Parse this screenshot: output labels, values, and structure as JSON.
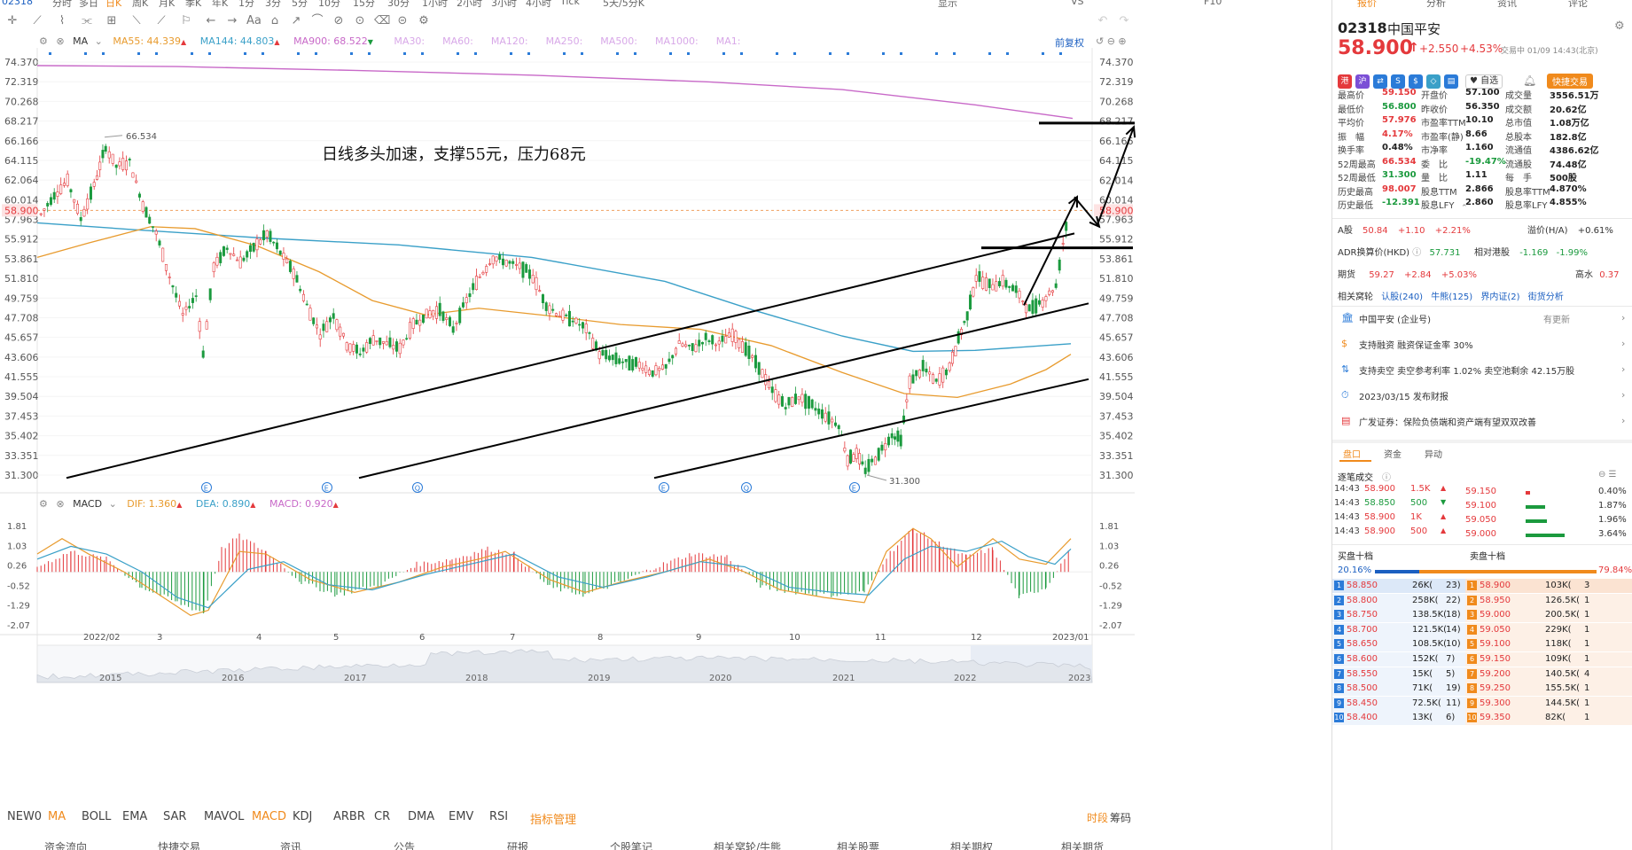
{
  "app": {
    "top_periods": [
      "02318",
      "分时",
      "多日",
      "日K",
      "周K",
      "月K",
      "季K",
      "年K",
      "1分",
      "3分",
      "5分",
      "10分",
      "15分",
      "30分",
      "1小时",
      "2小时",
      "3小时",
      "4小时",
      "Tick",
      "5天/5分K"
    ],
    "top_right": [
      "显示",
      "VS",
      "F10"
    ],
    "rpanel_tabs": [
      "报价",
      "分析",
      "资讯",
      "评论"
    ]
  },
  "chart": {
    "ma_legend": {
      "ma_label": "MA",
      "ma55": "MA55: 44.339",
      "ma144": "MA144: 44.803",
      "ma900": "MA900: 68.522",
      "others": [
        "MA30:",
        "MA60:",
        "MA120:",
        "MA250:",
        "MA500:",
        "MA1000:",
        "MA1:"
      ],
      "fuquan": "前复权"
    },
    "price_ticks": [
      "74.370",
      "72.319",
      "70.268",
      "68.217",
      "66.166",
      "64.115",
      "62.064",
      "60.014",
      "57.963",
      "55.912",
      "53.861",
      "51.810",
      "49.759",
      "47.708",
      "45.657",
      "43.606",
      "41.555",
      "39.504",
      "37.453",
      "35.402",
      "33.351",
      "31.300"
    ],
    "left_current_price": "58.900",
    "right_price_ticks": [
      "74.370",
      "72.319",
      "70.268",
      "68.217",
      "66.166",
      "64.115",
      "62.014",
      "60.014",
      "58.900",
      "57.963",
      "55.912",
      "53.861",
      "51.810",
      "49.759",
      "47.708",
      "45.657",
      "43.606",
      "41.555",
      "39.504",
      "37.453",
      "35.402",
      "33.351",
      "31.300"
    ],
    "high_label": "66.534",
    "low_label": "31.300",
    "annotation": "日线多头加速，支撑55元，压力68元",
    "event_markers": [
      "E",
      "E",
      "Q",
      "E",
      "Q",
      "E"
    ],
    "macd_legend": {
      "label": "MACD",
      "dif": "DIF: 1.360",
      "dea": "DEA: 0.890",
      "macd": "MACD: 0.920"
    },
    "macd_ticks": [
      "1.81",
      "1.03",
      "0.26",
      "-0.52",
      "-1.29",
      "-2.07"
    ],
    "x_months": [
      "2022/02",
      "3",
      "4",
      "5",
      "6",
      "7",
      "8",
      "9",
      "10",
      "11",
      "12",
      "2023/01"
    ],
    "overview_years": [
      "2015",
      "2016",
      "2017",
      "2018",
      "2019",
      "2020",
      "2021",
      "2022",
      "2023"
    ],
    "colors": {
      "ma55": "#e89b2e",
      "ma144": "#3aa0c8",
      "ma900": "#c869c8",
      "up": "#e4393c",
      "down": "#1b9a3e"
    }
  },
  "indicators": [
    "NEW0",
    "MA",
    "BOLL",
    "EMA",
    "SAR",
    "MAVOL",
    "MACD",
    "KDJ",
    "ARBR",
    "CR",
    "DMA",
    "EMV",
    "RSI",
    "指标管理"
  ],
  "indicators_right": [
    "时段",
    "筹码"
  ],
  "bottom_tabs": [
    "资金流向",
    "快捷交易",
    "资讯",
    "公告",
    "研报",
    "个股笔记",
    "相关窝轮/牛熊",
    "相关股票",
    "相关期权",
    "相关期货"
  ],
  "quote": {
    "code": "02318",
    "name": "中国平安",
    "price": "58.900",
    "change": "+2.550",
    "change_pct": "+4.53%",
    "trade_time": "交易中 01/09 14:43(北京)",
    "fav_label": "自选",
    "quick_trade": "快捷交易",
    "stats": [
      [
        "最高价",
        "59.150",
        "开盘价",
        "57.100",
        "成交量",
        "3556.51万"
      ],
      [
        "最低价",
        "56.800",
        "昨收价",
        "56.350",
        "成交额",
        "20.62亿"
      ],
      [
        "平均价",
        "57.976",
        "市盈率TTM",
        "10.10",
        "总市值",
        "1.08万亿"
      ],
      [
        "振　幅",
        "4.17%",
        "市盈率(静)",
        "8.66",
        "总股本",
        "182.8亿"
      ],
      [
        "换手率",
        "0.48%",
        "市净率",
        "1.160",
        "流通值",
        "4386.62亿"
      ],
      [
        "52周最高",
        "66.534",
        "委　比",
        "-19.47%",
        "流通股",
        "74.48亿"
      ],
      [
        "52周最低",
        "31.300",
        "量　比",
        "1.11",
        "每　手",
        "500股"
      ],
      [
        "历史最高",
        "98.007",
        "股息TTM",
        "2.866",
        "股息率TTM",
        "4.870%"
      ],
      [
        "历史最低",
        "-12.391",
        "股息LFY",
        "2.860",
        "股息率LFY",
        "4.855%"
      ]
    ],
    "a_share": {
      "label": "A股",
      "price": "50.84",
      "chg": "+1.10",
      "pct": "+2.21%",
      "premium_label": "溢价(H/A)",
      "premium": "+0.61%"
    },
    "adr": {
      "label": "ADR换算价(HKD)",
      "price": "57.731",
      "rel_label": "相对港股",
      "chg": "-1.169",
      "pct": "-1.99%"
    },
    "futures": {
      "label": "期货",
      "price": "59.27",
      "chg": "+2.84",
      "pct": "+5.03%",
      "high_label": "高水",
      "high": "0.37"
    },
    "warrants": {
      "label": "相关窝轮",
      "call": "认股(240)",
      "bull": "牛熊(125)",
      "inline": "界内证(2)",
      "analysis": "街货分析"
    },
    "info_rows": [
      {
        "text": "中国平安 (企业号)",
        "right": "有更新"
      },
      {
        "text": "支持融资  融资保证金率 30%",
        "right": ""
      },
      {
        "text": "支持卖空  卖空参考利率 1.02%  卖空池剩余 42.15万股",
        "right": ""
      },
      {
        "text": "2023/03/15  发布财报",
        "right": ""
      },
      {
        "text": "广发证券：保险负债端和资产端有望双双改善",
        "right": ""
      }
    ],
    "panel_tabs": [
      "盘口",
      "资金",
      "异动"
    ],
    "ticks_title": "逐笔成交",
    "ticks": [
      {
        "time": "14:43",
        "price": "58.900",
        "vol": "1.5K",
        "dir": "up"
      },
      {
        "time": "14:43",
        "price": "58.850",
        "vol": "500",
        "dir": "down"
      },
      {
        "time": "14:43",
        "price": "58.900",
        "vol": "1K",
        "dir": "up"
      },
      {
        "time": "14:43",
        "price": "58.900",
        "vol": "500",
        "dir": "up"
      }
    ],
    "price_dist": [
      {
        "price": "59.150",
        "pct": "0.40%"
      },
      {
        "price": "59.100",
        "pct": "1.87%"
      },
      {
        "price": "59.050",
        "pct": "1.96%"
      },
      {
        "price": "59.000",
        "pct": "3.64%"
      }
    ],
    "buy_title": "买盘十档",
    "sell_title": "卖盘十档",
    "buy_pct": "20.16%",
    "sell_pct": "79.84%",
    "bids": [
      [
        "1",
        "58.850",
        "26K(",
        "23)"
      ],
      [
        "2",
        "58.800",
        "258K(",
        "22)"
      ],
      [
        "3",
        "58.750",
        "138.5K(",
        "18)"
      ],
      [
        "4",
        "58.700",
        "121.5K(",
        "14)"
      ],
      [
        "5",
        "58.650",
        "108.5K(",
        "10)"
      ],
      [
        "6",
        "58.600",
        "152K(",
        "7)"
      ],
      [
        "7",
        "58.550",
        "15K(",
        "5)"
      ],
      [
        "8",
        "58.500",
        "71K(",
        "19)"
      ],
      [
        "9",
        "58.450",
        "72.5K(",
        "11)"
      ],
      [
        "10",
        "58.400",
        "13K(",
        "6)"
      ]
    ],
    "asks": [
      [
        "1",
        "58.900",
        "103K(",
        "3"
      ],
      [
        "2",
        "58.950",
        "126.5K(",
        "1"
      ],
      [
        "3",
        "59.000",
        "200.5K(",
        "1"
      ],
      [
        "4",
        "59.050",
        "229K(",
        "1"
      ],
      [
        "5",
        "59.100",
        "118K(",
        "1"
      ],
      [
        "6",
        "59.150",
        "109K(",
        "1"
      ],
      [
        "7",
        "59.200",
        "140.5K(",
        "4"
      ],
      [
        "8",
        "59.250",
        "155.5K(",
        "1"
      ],
      [
        "9",
        "59.300",
        "144.5K(",
        "1"
      ],
      [
        "10",
        "59.350",
        "82K(",
        "1"
      ]
    ]
  }
}
